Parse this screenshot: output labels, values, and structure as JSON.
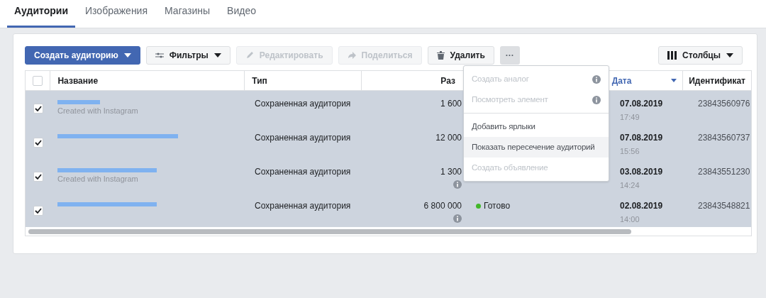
{
  "tabs": [
    {
      "label": "Аудитории",
      "selected": true
    },
    {
      "label": "Изображения",
      "selected": false
    },
    {
      "label": "Магазины",
      "selected": false
    },
    {
      "label": "Видео",
      "selected": false
    }
  ],
  "toolbar": {
    "create": "Создать аудиторию",
    "filters": "Фильтры",
    "edit": {
      "label": "Редактировать",
      "disabled": true
    },
    "share": {
      "label": "Поделиться",
      "disabled": true
    },
    "delete": "Удалить",
    "more": "···",
    "columns": "Столбцы"
  },
  "table": {
    "all_checked": false,
    "columns": [
      "Название",
      "Тип",
      "Раз",
      "Дата",
      "Идентификат"
    ],
    "rows": [
      {
        "checked": true,
        "name_redacted": true,
        "subtitle": "Created with Instagram",
        "type": "Сохраненная аудитория",
        "size": "1 600",
        "size_info": false,
        "status": null,
        "date": "07.08.2019",
        "time": "17:49",
        "id": "23843560976"
      },
      {
        "checked": true,
        "name_redacted": true,
        "subtitle": null,
        "type": "Сохраненная аудитория",
        "size": "12 000",
        "size_info": false,
        "status": null,
        "date": "07.08.2019",
        "time": "15:56",
        "id": "23843560737"
      },
      {
        "checked": true,
        "name_redacted": true,
        "subtitle": "Created with Instagram",
        "type": "Сохраненная аудитория",
        "size": "1 300",
        "size_info": true,
        "status": null,
        "date": "03.08.2019",
        "time": "14:24",
        "id": "23843551230"
      },
      {
        "checked": true,
        "name_redacted": true,
        "subtitle": null,
        "type": "Сохраненная аудитория",
        "size": "6 800 000",
        "size_info": true,
        "status": {
          "label": "Готово",
          "color": "#42b72a"
        },
        "date": "02.08.2019",
        "time": "14:00",
        "id": "23843548821"
      }
    ]
  },
  "menu": {
    "items": [
      {
        "label": "Создать аналог",
        "disabled": true,
        "info": true,
        "selected": false
      },
      {
        "label": "Посмотреть элемент",
        "disabled": true,
        "info": true,
        "selected": false
      },
      {
        "label": "Добавить ярлыки",
        "disabled": false,
        "info": false,
        "selected": false
      },
      {
        "label": "Показать пересечение аудиторий",
        "disabled": false,
        "info": false,
        "selected": true
      },
      {
        "label": "Создать объявление",
        "disabled": true,
        "info": false,
        "selected": false
      }
    ]
  }
}
